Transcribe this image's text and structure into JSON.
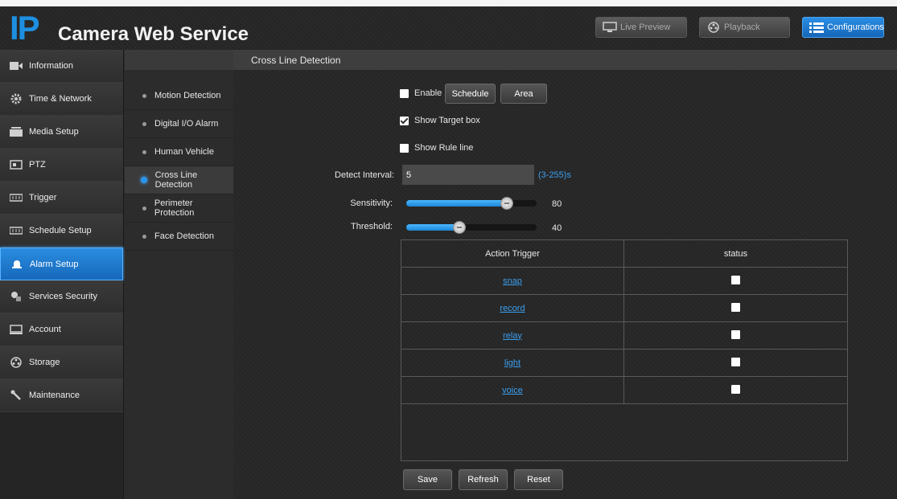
{
  "header": {
    "logo_ip": "IP",
    "logo_text": "Camera Web Service",
    "buttons": {
      "live_preview": "Live Preview",
      "playback": "Playback",
      "configurations": "Configurations"
    }
  },
  "leftnav": {
    "items": [
      {
        "label": "Information",
        "icon": "film-icon"
      },
      {
        "label": "Time & Network",
        "icon": "gear-icon"
      },
      {
        "label": "Media Setup",
        "icon": "media-icon"
      },
      {
        "label": "PTZ",
        "icon": "ptz-icon"
      },
      {
        "label": "Trigger",
        "icon": "trigger-icon"
      },
      {
        "label": "Schedule Setup",
        "icon": "schedule-icon"
      },
      {
        "label": "Alarm Setup",
        "icon": "alarm-icon",
        "active": true
      },
      {
        "label": "Services Security",
        "icon": "security-icon"
      },
      {
        "label": "Account",
        "icon": "monitor-icon"
      },
      {
        "label": "Storage",
        "icon": "storage-icon"
      },
      {
        "label": "Maintenance",
        "icon": "wrench-icon"
      }
    ]
  },
  "subnav": {
    "items": [
      {
        "label": "Motion Detection"
      },
      {
        "label": "Digital I/O Alarm"
      },
      {
        "label": "Human Vehicle"
      },
      {
        "label": "Cross Line Detection",
        "active": true
      },
      {
        "label": "Perimeter Protection"
      },
      {
        "label": "Face Detection"
      }
    ]
  },
  "main": {
    "title": "Cross Line Detection",
    "enable_label": "Enable",
    "enable_checked": false,
    "schedule_button": "Schedule",
    "area_button": "Area",
    "show_target_box_label": "Show Target box",
    "show_target_box_checked": true,
    "show_rule_line_label": "Show Rule line",
    "show_rule_line_checked": false,
    "detect_interval_label": "Detect Interval:",
    "detect_interval_value": "5",
    "detect_interval_range": "(3-255)s",
    "sensitivity_label": "Sensitivity:",
    "sensitivity_value": "80",
    "sensitivity_fraction": 0.8,
    "threshold_label": "Threshold:",
    "threshold_value": "40",
    "threshold_fraction": 0.4,
    "table": {
      "col_action": "Action Trigger",
      "col_status": "status",
      "rows": [
        {
          "action": "snap",
          "checked": false
        },
        {
          "action": "record",
          "checked": false
        },
        {
          "action": "relay",
          "checked": false
        },
        {
          "action": "light",
          "checked": false
        },
        {
          "action": "voice",
          "checked": false
        }
      ]
    },
    "save_button": "Save",
    "refresh_button": "Refresh",
    "reset_button": "Reset"
  },
  "colors": {
    "accent": "#1d8fe0",
    "link": "#3a9ff0"
  }
}
